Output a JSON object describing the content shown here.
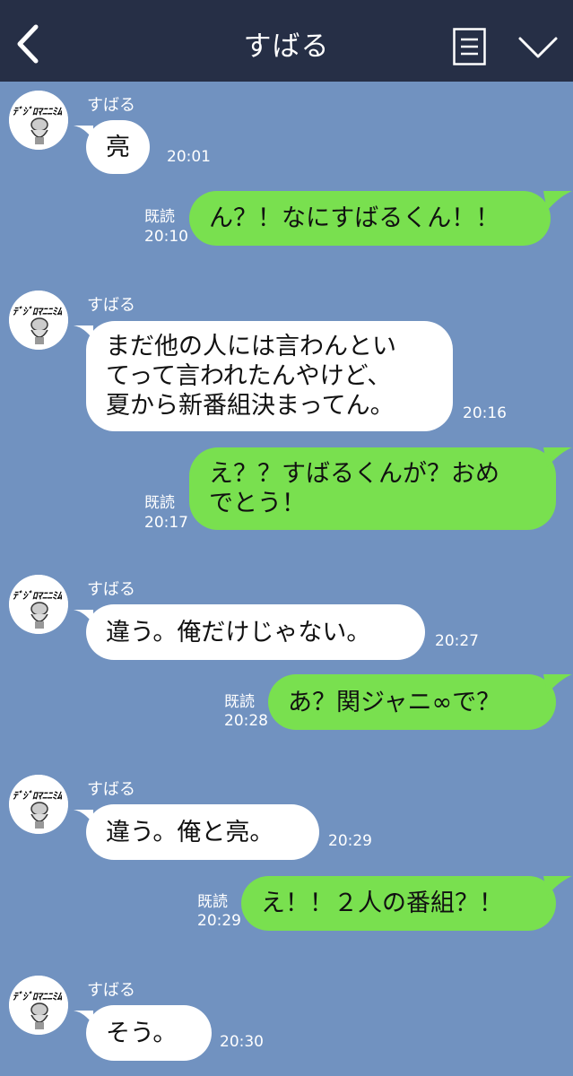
{
  "header": {
    "title": "すばる",
    "back_icon": "chevron-left-icon",
    "menu_icon": "list-icon",
    "collapse_icon": "chevron-down-icon"
  },
  "messages": [
    {
      "type": "in",
      "sender": "すばる",
      "text": "亮",
      "time": "20:01"
    },
    {
      "type": "out",
      "read": "既読",
      "text": "ん？！なにすばるくん！！",
      "time": "20:10"
    },
    {
      "type": "in",
      "sender": "すばる",
      "text": "まだ他の人には言わんとい\nてって言われたんやけど、\n夏から新番組決まってん。",
      "time": "20:16"
    },
    {
      "type": "out",
      "read": "既読",
      "text": "え？？すばるくんが？おめ\nでとう！",
      "time": "20:17"
    },
    {
      "type": "in",
      "sender": "すばる",
      "text": "違う。俺だけじゃない。",
      "time": "20:27"
    },
    {
      "type": "out",
      "read": "既読",
      "text": "あ？関ジャニ∞で？",
      "time": "20:28"
    },
    {
      "type": "in",
      "sender": "すばる",
      "text": "違う。俺と亮。",
      "time": "20:29"
    },
    {
      "type": "out",
      "read": "既読",
      "text": "え！！２人の番組？！",
      "time": "20:29"
    },
    {
      "type": "in",
      "sender": "すばる",
      "text": "そう。",
      "time": "20:30"
    }
  ],
  "colors": {
    "header_bg": "#262f46",
    "chat_bg": "#7192c0",
    "incoming_bubble": "#ffffff",
    "outgoing_bubble": "#79e04f"
  }
}
